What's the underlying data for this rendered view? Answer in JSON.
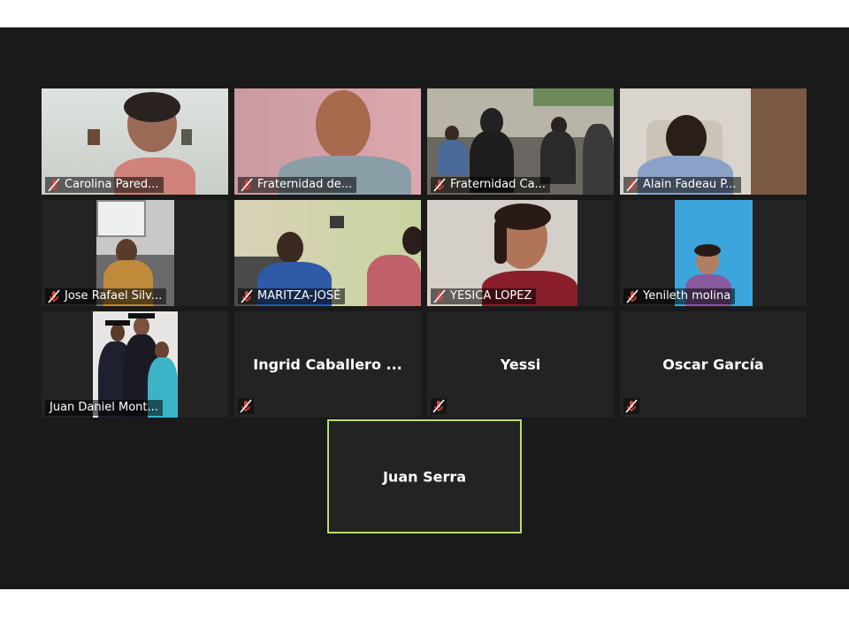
{
  "participants": [
    {
      "name": "Carolina Pared...",
      "muted": true
    },
    {
      "name": "Fraternidad de...",
      "muted": true
    },
    {
      "name": "Fraternidad Ca...",
      "muted": true
    },
    {
      "name": "Alain Fadeau P...",
      "muted": true
    },
    {
      "name": "Jose Rafael Silv...",
      "muted": true
    },
    {
      "name": "MARITZA-JOSÉ",
      "muted": true
    },
    {
      "name": "YESICA LOPEZ",
      "muted": true
    },
    {
      "name": "Yenileth molina",
      "muted": true
    },
    {
      "name": "Juan Daniel Mont...",
      "muted": false
    },
    {
      "name": "Ingrid  Caballero ...",
      "muted": true
    },
    {
      "name": "Yessi",
      "muted": true
    },
    {
      "name": "Oscar García",
      "muted": true
    }
  ],
  "active_speaker": {
    "name": "Juan Serra"
  },
  "icons": {
    "mic": "muted-mic-icon"
  },
  "colors": {
    "background": "#1a1a1a",
    "tile": "#232323",
    "speaker_border": "#b8e06a",
    "mute_icon": "#e0403a"
  }
}
